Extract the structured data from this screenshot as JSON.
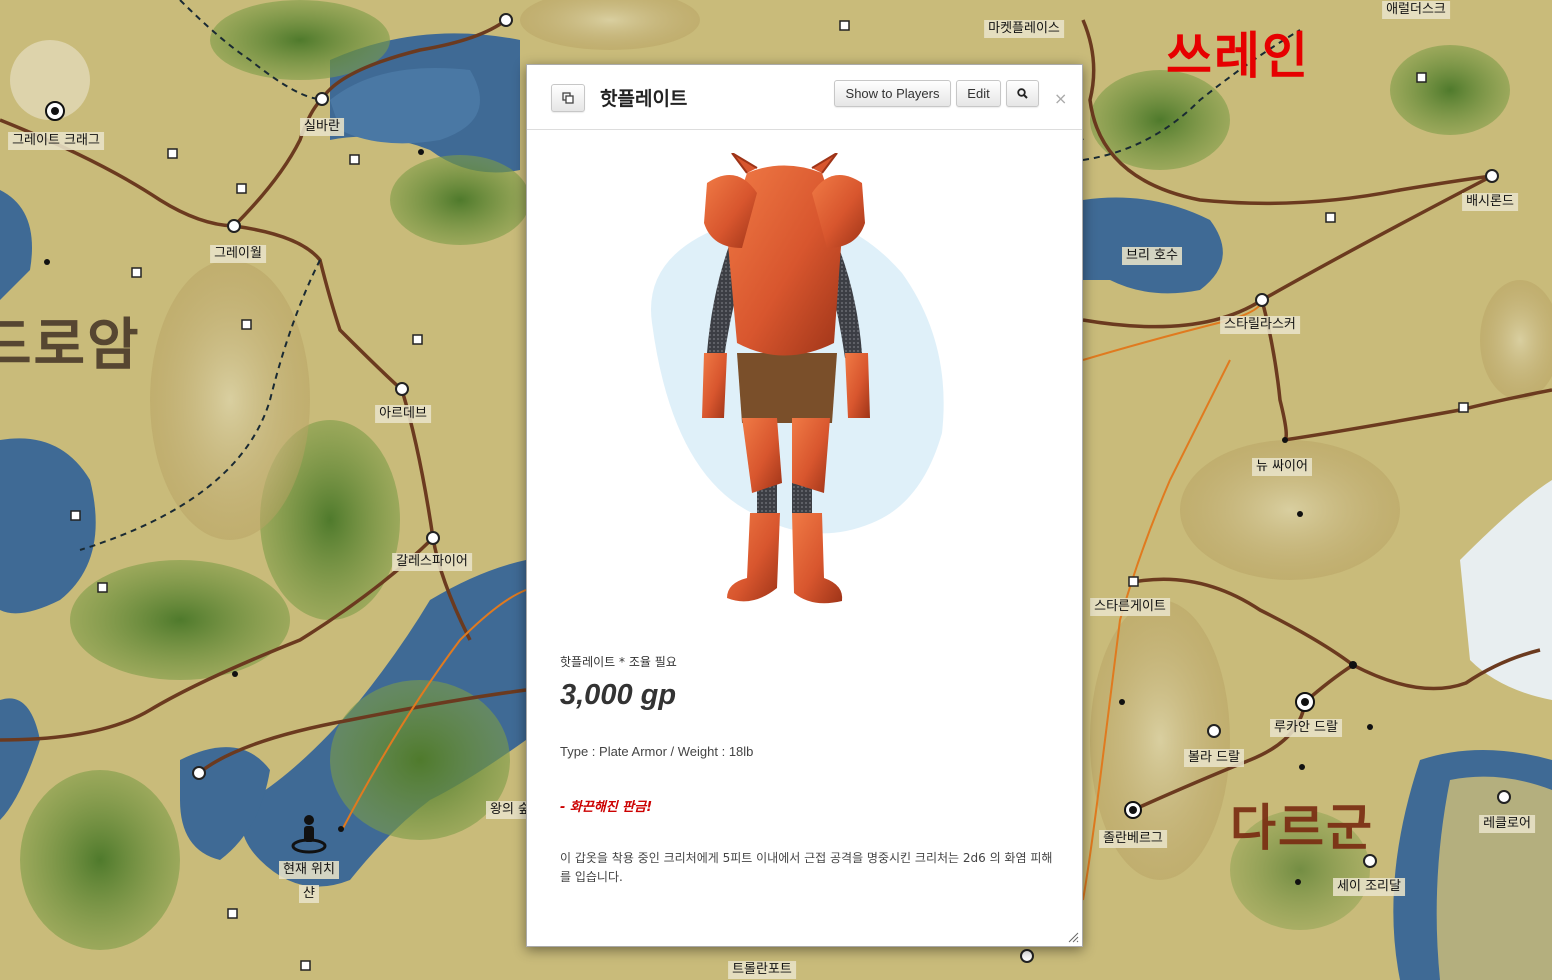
{
  "map": {
    "regions": {
      "thrane": "쓰레인",
      "brelam": "드로암",
      "darguun": "다르군"
    },
    "locations": {
      "great_crag": "그레이트 크래그",
      "silvaran": "실바란",
      "greywall": "그레이월",
      "ardev": "아르데브",
      "galesfire": "갈레스파이어",
      "marketplace": "마켓플레이스",
      "aereldesk": "애럴더스크",
      "bashirond": "배시론드",
      "brie_lake": "브리 호수",
      "starilaskur": "스타릴라스커",
      "new_cyre": "뉴 싸이어",
      "stargate": "스타른게이트",
      "lukan_dral": "루카안 드랄",
      "bula_dral": "볼라 드랄",
      "zolanberg": "졸란베르그",
      "rekkenmark": "레클로어",
      "seyi_zoridal": "세이 조리달",
      "kings_forest": "왕의 숲",
      "current_position": "현재 위치",
      "shan": "샨",
      "trolanport": "트롤란포트"
    },
    "player_marker_icon": "player-position-icon"
  },
  "dialog": {
    "title": "핫플레이트",
    "buttons": {
      "popout_icon": "popout-icon",
      "show_to_players": "Show to Players",
      "edit": "Edit",
      "search_icon": "search-icon"
    },
    "close_label": "×",
    "item": {
      "subtitle": "핫플레이트 * 조율 필요",
      "price": "3,000 gp",
      "type_line": "Type : Plate Armor / Weight : 18lb",
      "ability_name": "- 화끈해진 판금!",
      "description": "이 갑옷을 착용 중인 크리처에게 5피트 이내에서 근접 공격을 명중시킨 크리처는 2d6 의 화염 피해를 입습니다."
    }
  },
  "colors": {
    "land": "#c9bb7a",
    "water": "#3f6a95",
    "road": "#6b3a1f",
    "armor": "#d8562e",
    "thrane_label": "#e60000"
  }
}
